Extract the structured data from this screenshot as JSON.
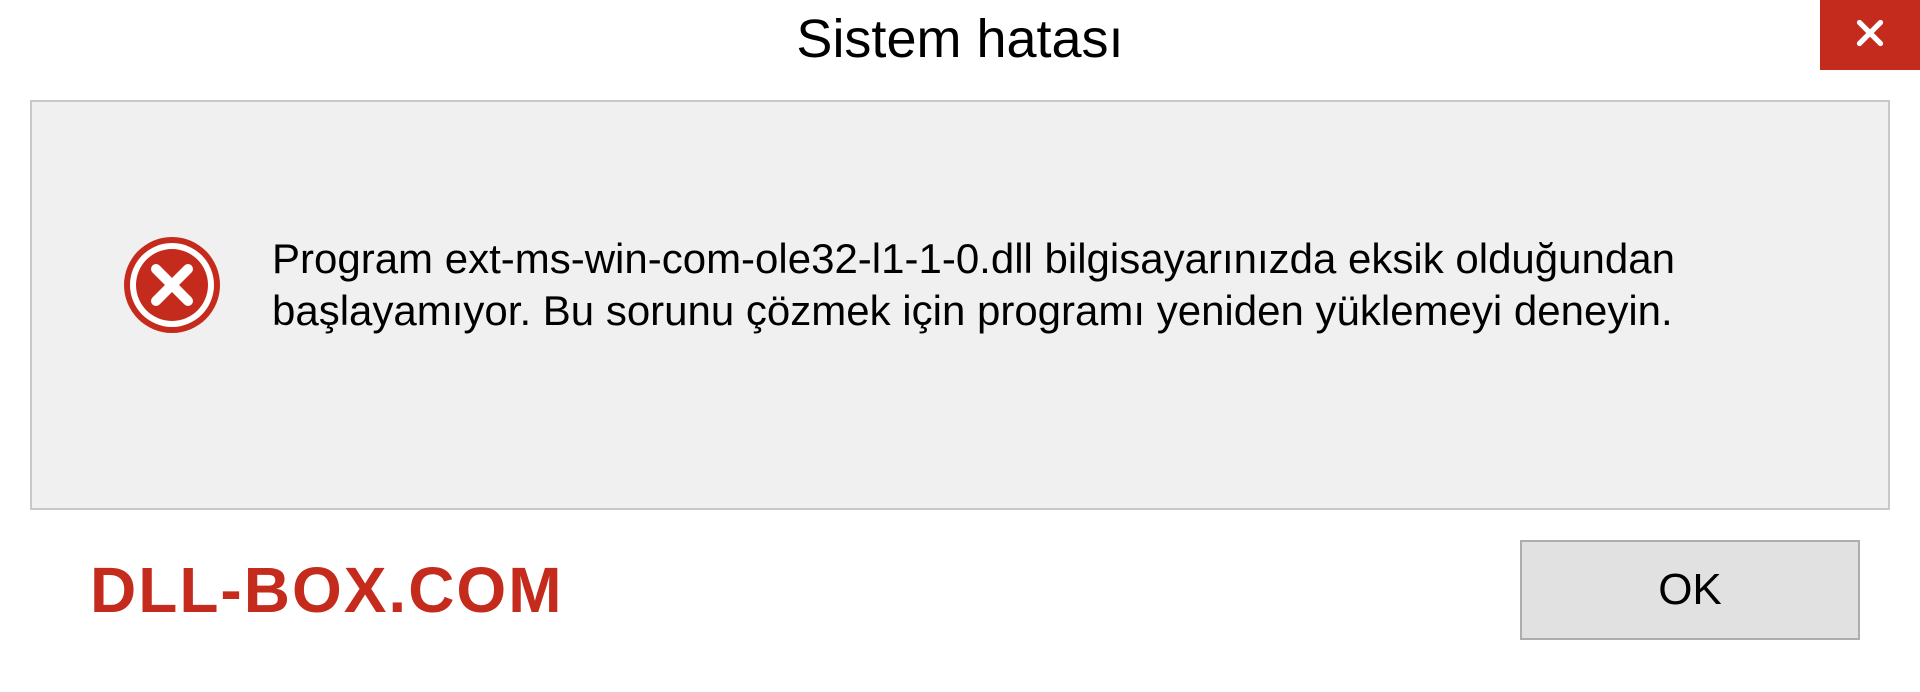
{
  "dialog": {
    "title": "Sistem hatası",
    "message": "Program ext-ms-win-com-ole32-l1-1-0.dll bilgisayarınızda eksik olduğundan başlayamıyor. Bu sorunu çözmek için programı yeniden yüklemeyi deneyin.",
    "ok_label": "OK"
  },
  "watermark": "DLL-BOX.COM",
  "colors": {
    "accent_red": "#c42b1c",
    "panel_bg": "#f0f0f0",
    "panel_border": "#c8c8c8",
    "button_bg": "#e1e1e1",
    "button_border": "#adadad"
  }
}
